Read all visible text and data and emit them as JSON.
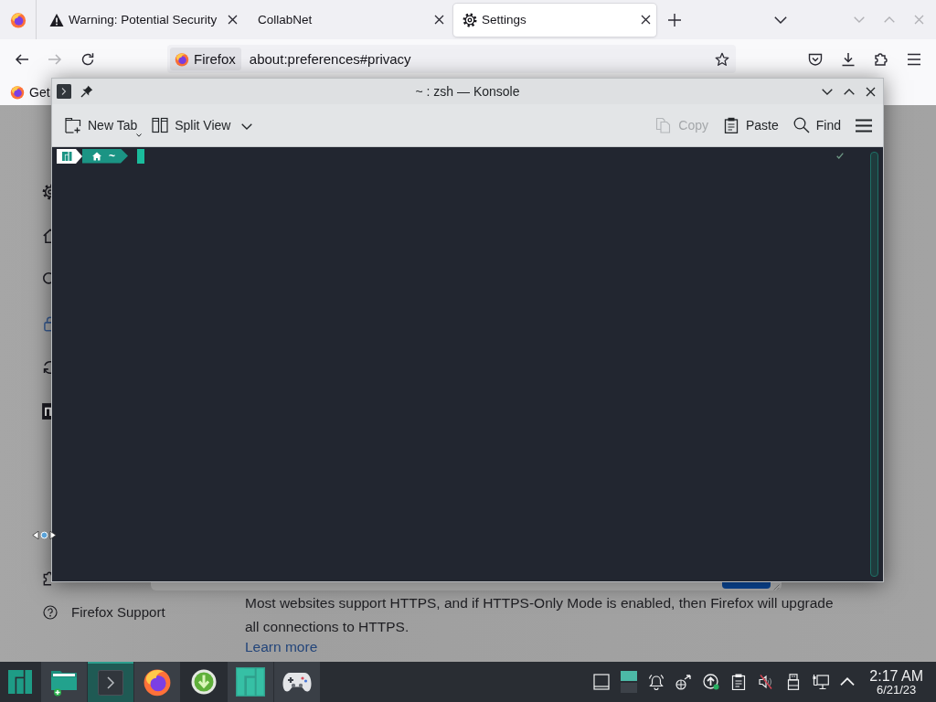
{
  "firefox": {
    "tabs": [
      {
        "title": "Warning: Potential Security",
        "kind": "warning",
        "selected": false
      },
      {
        "title": "CollabNet",
        "kind": "plain",
        "selected": false
      },
      {
        "title": "Settings",
        "kind": "settings",
        "selected": true
      }
    ],
    "address_bar": {
      "identity": "Firefox",
      "url": "about:preferences#privacy"
    },
    "bookmarks": [
      {
        "label": "Get"
      }
    ],
    "sidebar": {
      "items": [
        {
          "kind": "general",
          "selected": false
        },
        {
          "kind": "home",
          "selected": false
        },
        {
          "kind": "search",
          "selected": false
        },
        {
          "kind": "privacy",
          "selected": true
        },
        {
          "kind": "sync",
          "selected": false
        },
        {
          "kind": "more",
          "selected": false
        }
      ],
      "footer": [
        {
          "kind": "extensions"
        },
        {
          "kind": "support",
          "label": "Firefox Support"
        }
      ]
    },
    "content": {
      "text": "Most websites support HTTPS, and if HTTPS-Only Mode is enabled, then Firefox will upgrade all connections to HTTPS.",
      "link": "Learn more"
    }
  },
  "konsole": {
    "title": "~ : zsh — Konsole",
    "toolbar": [
      {
        "label": "New Tab",
        "kind": "new-tab",
        "disabled": false
      },
      {
        "label": "Split View",
        "kind": "split-view",
        "disabled": false
      },
      {
        "label": "Copy",
        "kind": "copy",
        "disabled": true
      },
      {
        "label": "Paste",
        "kind": "paste",
        "disabled": false
      },
      {
        "label": "Find",
        "kind": "find",
        "disabled": false
      }
    ],
    "prompt": {
      "path": "~"
    }
  },
  "taskbar": {
    "apps": [
      {
        "kind": "folder",
        "active": false,
        "running": true
      },
      {
        "kind": "terminal",
        "active": true,
        "running": true
      },
      {
        "kind": "firefox",
        "active": false,
        "running": true
      },
      {
        "kind": "download",
        "active": false,
        "running": false
      },
      {
        "kind": "logo",
        "active": false,
        "running": true
      },
      {
        "kind": "gamepad",
        "active": false,
        "running": true
      }
    ],
    "tray": {
      "muted": true
    },
    "clock": {
      "time": "2:17 AM",
      "date": "6/21/23"
    }
  }
}
